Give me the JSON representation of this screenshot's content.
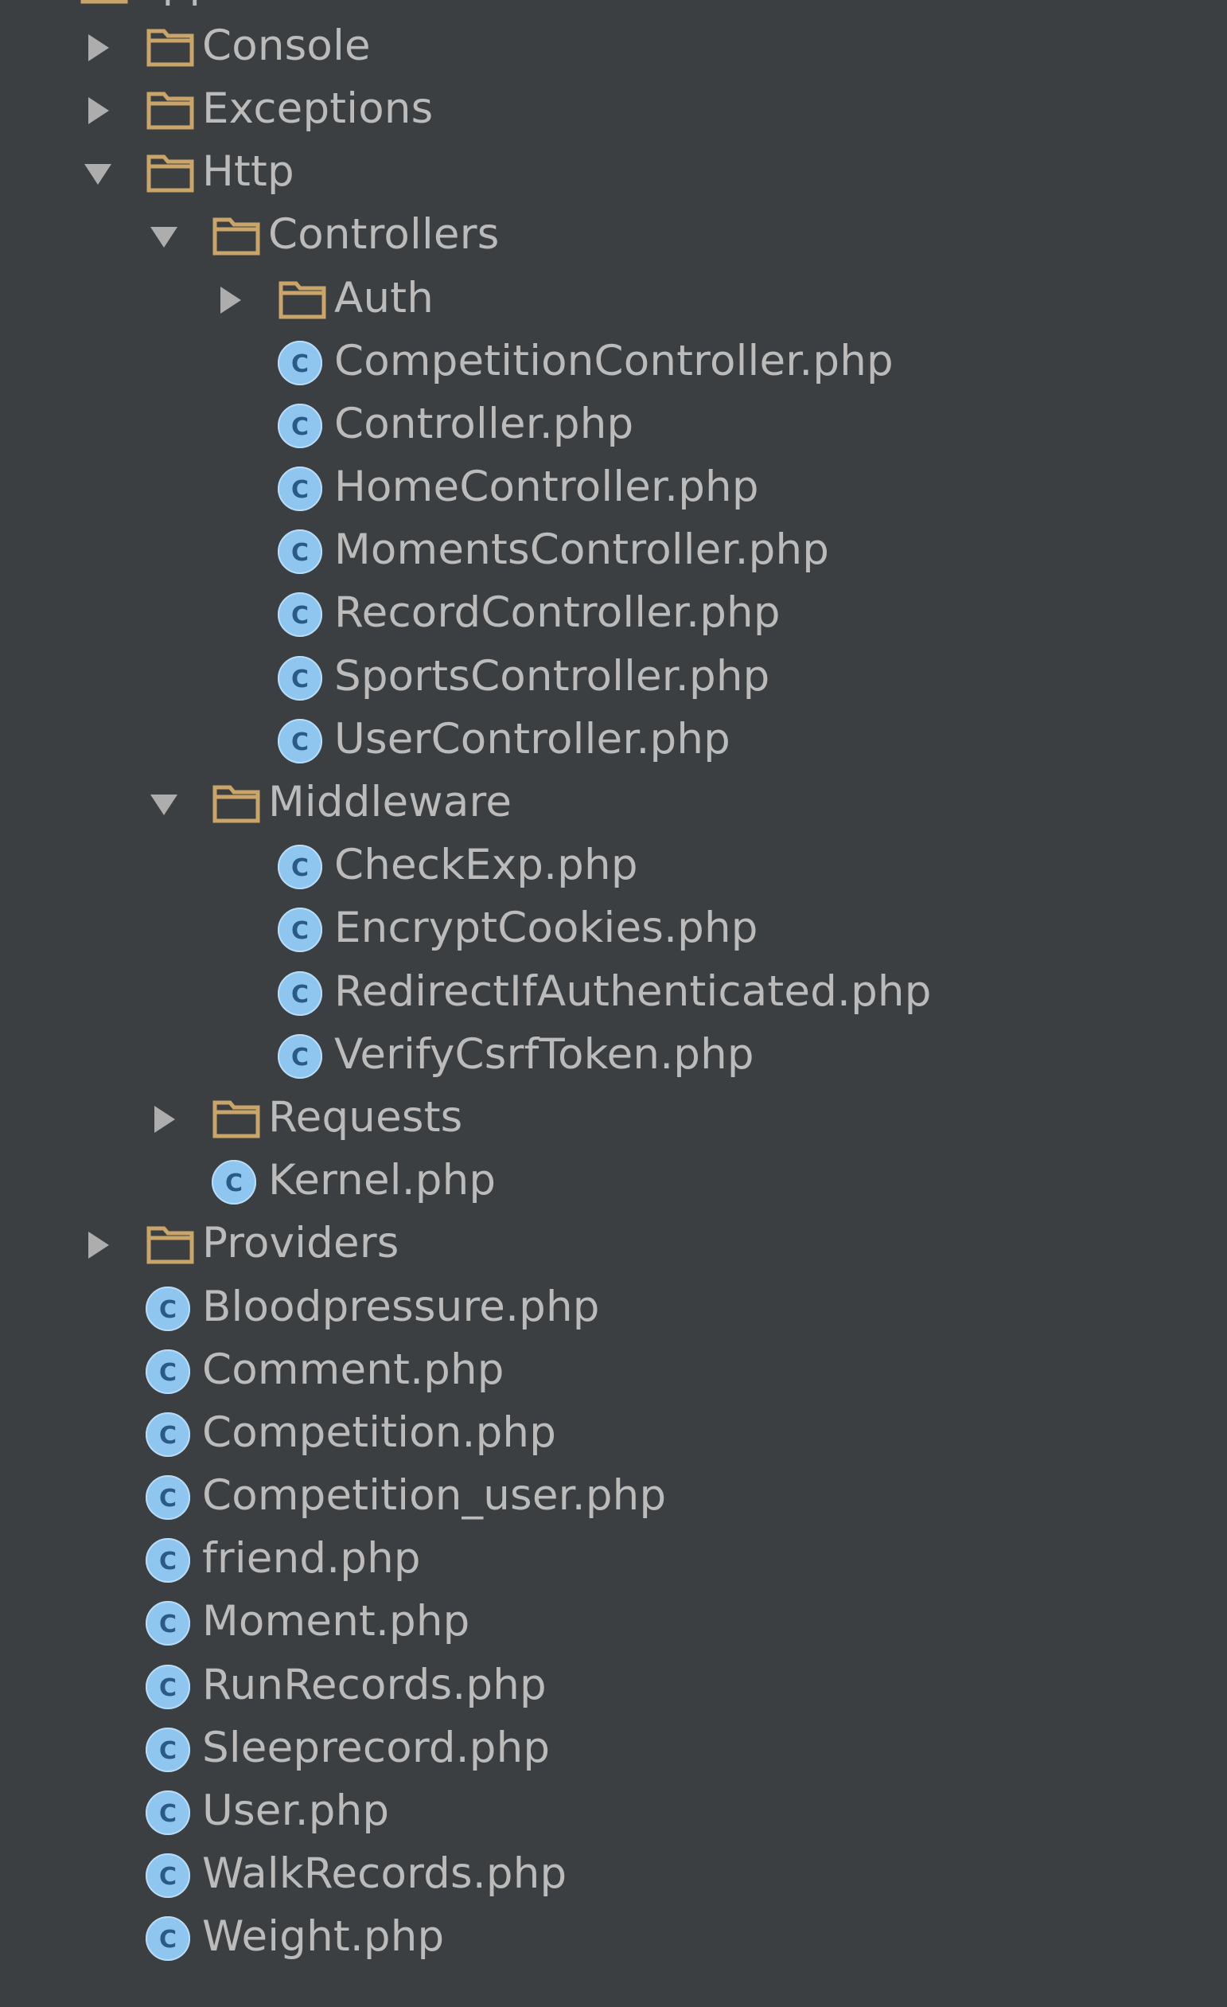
{
  "project_tree": {
    "colors": {
      "background": "#3c3f41",
      "text": "#bbbbbb",
      "folder_icon": "#c9a56a",
      "class_icon_fill": "#8ec6f0",
      "class_icon_letter": "#2b5a86",
      "arrow": "#adadad"
    },
    "nodes": [
      {
        "label": "app",
        "type": "folder",
        "depth": 0,
        "state": "expanded"
      },
      {
        "label": "Console",
        "type": "folder",
        "depth": 1,
        "state": "collapsed"
      },
      {
        "label": "Exceptions",
        "type": "folder",
        "depth": 1,
        "state": "collapsed"
      },
      {
        "label": "Http",
        "type": "folder",
        "depth": 1,
        "state": "expanded"
      },
      {
        "label": "Controllers",
        "type": "folder",
        "depth": 2,
        "state": "expanded"
      },
      {
        "label": "Auth",
        "type": "folder",
        "depth": 3,
        "state": "collapsed"
      },
      {
        "label": "CompetitionController.php",
        "type": "class",
        "depth": 3
      },
      {
        "label": "Controller.php",
        "type": "class",
        "depth": 3
      },
      {
        "label": "HomeController.php",
        "type": "class",
        "depth": 3
      },
      {
        "label": "MomentsController.php",
        "type": "class",
        "depth": 3
      },
      {
        "label": "RecordController.php",
        "type": "class",
        "depth": 3
      },
      {
        "label": "SportsController.php",
        "type": "class",
        "depth": 3
      },
      {
        "label": "UserController.php",
        "type": "class",
        "depth": 3
      },
      {
        "label": "Middleware",
        "type": "folder",
        "depth": 2,
        "state": "expanded"
      },
      {
        "label": "CheckExp.php",
        "type": "class",
        "depth": 3
      },
      {
        "label": "EncryptCookies.php",
        "type": "class",
        "depth": 3
      },
      {
        "label": "RedirectIfAuthenticated.php",
        "type": "class",
        "depth": 3
      },
      {
        "label": "VerifyCsrfToken.php",
        "type": "class",
        "depth": 3
      },
      {
        "label": "Requests",
        "type": "folder",
        "depth": 2,
        "state": "collapsed"
      },
      {
        "label": "Kernel.php",
        "type": "class",
        "depth": 2
      },
      {
        "label": "Providers",
        "type": "folder",
        "depth": 1,
        "state": "collapsed"
      },
      {
        "label": "Bloodpressure.php",
        "type": "class",
        "depth": 1
      },
      {
        "label": "Comment.php",
        "type": "class",
        "depth": 1
      },
      {
        "label": "Competition.php",
        "type": "class",
        "depth": 1
      },
      {
        "label": "Competition_user.php",
        "type": "class",
        "depth": 1
      },
      {
        "label": "friend.php",
        "type": "class",
        "depth": 1
      },
      {
        "label": "Moment.php",
        "type": "class",
        "depth": 1
      },
      {
        "label": "RunRecords.php",
        "type": "class",
        "depth": 1
      },
      {
        "label": "Sleeprecord.php",
        "type": "class",
        "depth": 1
      },
      {
        "label": "User.php",
        "type": "class",
        "depth": 1
      },
      {
        "label": "WalkRecords.php",
        "type": "class",
        "depth": 1
      },
      {
        "label": "Weight.php",
        "type": "class",
        "depth": 1
      }
    ]
  }
}
